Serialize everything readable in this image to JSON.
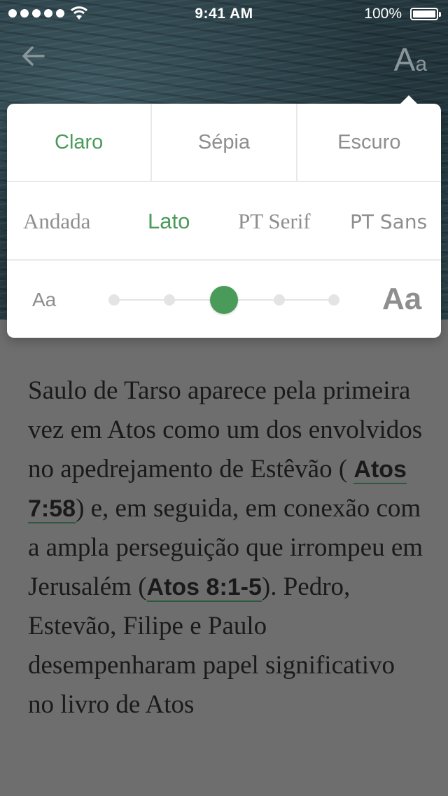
{
  "status_bar": {
    "time": "9:41 AM",
    "battery": "100%",
    "signal_icon": "signal-dots-icon",
    "wifi_icon": "wifi-icon"
  },
  "nav": {
    "back_icon": "back-arrow-icon",
    "font_settings_label_big": "A",
    "font_settings_label_small": "a"
  },
  "popover": {
    "themes": [
      {
        "label": "Claro",
        "active": true
      },
      {
        "label": "Sépia",
        "active": false
      },
      {
        "label": "Escuro",
        "active": false
      }
    ],
    "fonts": [
      {
        "label": "Andada",
        "active": false
      },
      {
        "label": "Lato",
        "active": true
      },
      {
        "label": "PT Serif",
        "active": false
      },
      {
        "label": "PT Sans",
        "active": false
      }
    ],
    "size": {
      "small_label": "Aa",
      "large_label": "Aa",
      "steps": 5,
      "selected_step": 3
    },
    "accent_color": "#4a9a5a"
  },
  "article": {
    "segments": [
      "Saulo de Tarso aparece pela primeira vez em Atos como um dos envolvidos no apedrejamento de Estêvão ( ",
      "Atos 7:58",
      ") e, em seguida, em conexão com a ampla perseguição que irrompeu em Jerusalém (",
      "Atos 8:1-5",
      "). Pedro, Estevão, Filipe e Paulo desempenharam papel significativo no livro de Atos"
    ]
  }
}
